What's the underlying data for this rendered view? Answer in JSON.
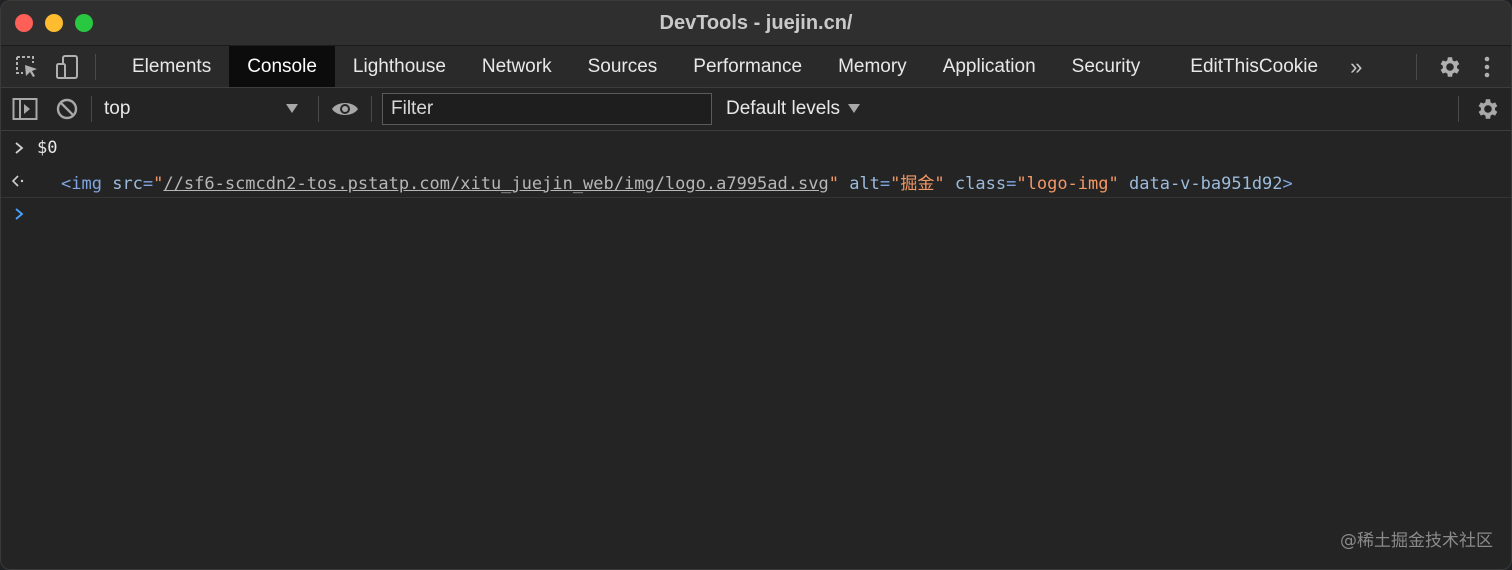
{
  "window": {
    "title": "DevTools - juejin.cn/"
  },
  "tabs": [
    {
      "label": "Elements"
    },
    {
      "label": "Console"
    },
    {
      "label": "Lighthouse"
    },
    {
      "label": "Network"
    },
    {
      "label": "Sources"
    },
    {
      "label": "Performance"
    },
    {
      "label": "Memory"
    },
    {
      "label": "Application"
    },
    {
      "label": "Security"
    },
    {
      "label": "EditThisCookie"
    }
  ],
  "active_tab": "Console",
  "more_tabs_label": "»",
  "console_toolbar": {
    "context": "top",
    "filter_placeholder": "Filter",
    "levels_label": "Default levels"
  },
  "console": {
    "input_command": "$0",
    "output": {
      "open": "<img",
      "src_attr": "src",
      "src_value": "//sf6-scmcdn2-tos.pstatp.com/xitu_juejin_web/img/logo.a7995ad.svg",
      "alt_attr": "alt",
      "alt_value": "掘金",
      "class_attr": "class",
      "class_value": "logo-img",
      "data_attr": "data-v-ba951d92",
      "close": ">"
    }
  },
  "watermark": "@稀土掘金技术社区",
  "colors": {
    "background": "#242424",
    "active_tab": "#0c0c0c",
    "prompt_active": "#4aa3ff",
    "attr_value": "#f29766",
    "tag": "#7fa6e1"
  }
}
